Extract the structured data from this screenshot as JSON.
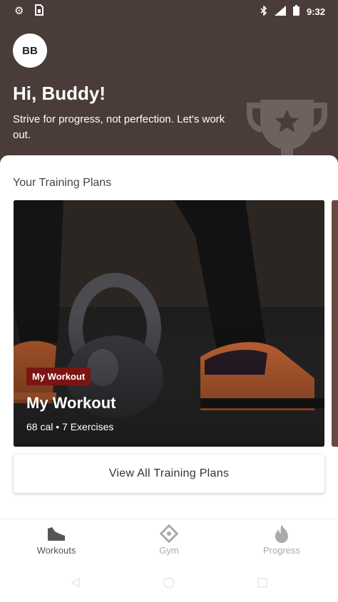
{
  "status_bar": {
    "time": "9:32"
  },
  "header": {
    "avatar_initials": "BB",
    "greeting": "Hi, Buddy!",
    "tagline": "Strive for progress, not perfection. Let's work out."
  },
  "training": {
    "section_title": "Your Training Plans",
    "card": {
      "badge": "My Workout",
      "title": "My Workout",
      "meta": "68 cal • 7 Exercises"
    },
    "view_all_label": "View All Training Plans"
  },
  "bottom_nav": {
    "items": [
      {
        "label": "Workouts",
        "icon": "shoe-icon",
        "active": true
      },
      {
        "label": "Gym",
        "icon": "gym-icon",
        "active": false
      },
      {
        "label": "Progress",
        "icon": "flame-icon",
        "active": false
      }
    ]
  },
  "colors": {
    "header_bg": "#4a3c39",
    "badge_bg": "#7b1512",
    "active_nav": "#555555",
    "inactive_nav": "#aaaaaa"
  }
}
